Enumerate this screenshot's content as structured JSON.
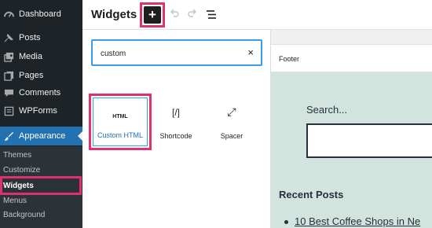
{
  "sidebar": {
    "menu": [
      {
        "label": "Dashboard",
        "icon": "dashboard-icon"
      },
      {
        "label": "Posts",
        "icon": "pin-icon"
      },
      {
        "label": "Media",
        "icon": "media-icon"
      },
      {
        "label": "Pages",
        "icon": "pages-icon"
      },
      {
        "label": "Comments",
        "icon": "comments-icon"
      },
      {
        "label": "WPForms",
        "icon": "wpforms-icon"
      },
      {
        "label": "Appearance",
        "icon": "brush-icon"
      }
    ],
    "submenu": [
      "Themes",
      "Customize",
      "Widgets",
      "Menus",
      "Background"
    ],
    "active_color": "#2271b1"
  },
  "header": {
    "title": "Widgets",
    "add_label": "+"
  },
  "inserter": {
    "search_value": "custom",
    "clear_label": "×",
    "blocks": [
      {
        "icon_text": "HTML",
        "label": "Custom HTML"
      },
      {
        "icon_text": "[/]",
        "label": "Shortcode"
      },
      {
        "icon_text": "⤢",
        "label": "Spacer"
      }
    ]
  },
  "preview": {
    "area_label": "Footer",
    "search_title": "Search...",
    "recent_title": "Recent Posts",
    "recent_item": "10 Best Coffee Shops in Ne"
  },
  "colors": {
    "highlight": "#e0316f",
    "sidebar_bg": "#1d2327",
    "preview_bg": "#d1e4dd"
  }
}
